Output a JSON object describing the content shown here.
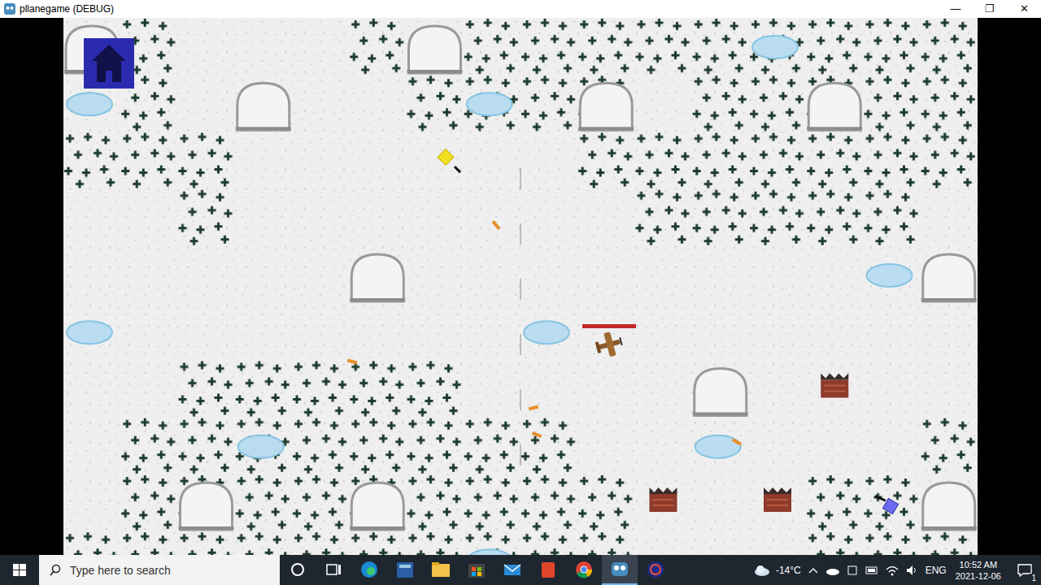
{
  "window": {
    "title": "pllanegame (DEBUG)",
    "controls": [
      "—",
      "❐",
      "✕"
    ]
  },
  "game": {
    "player": {
      "health_level": 1
    }
  },
  "taskbar": {
    "search": {
      "placeholder": "Type here to search"
    },
    "weather": {
      "temperature": "-14°C"
    },
    "language": "ENG",
    "clock": {
      "time": "10:52 AM",
      "date": "2021-12-06"
    },
    "notifications": {
      "count": "1"
    }
  }
}
